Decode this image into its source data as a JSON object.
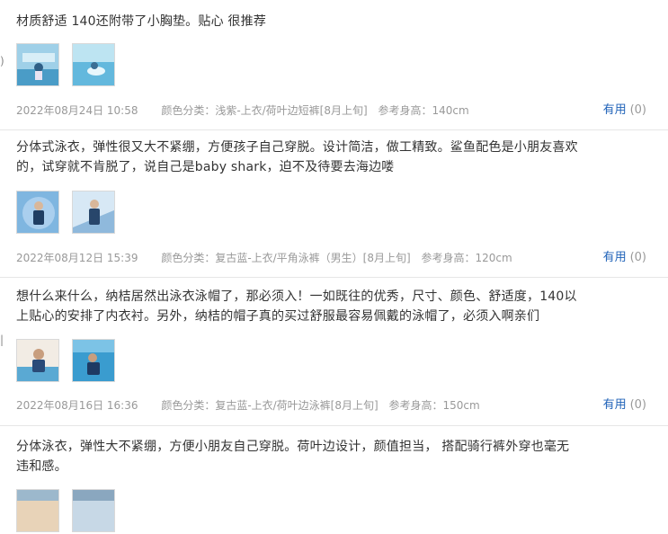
{
  "reviews": [
    {
      "lines": [
        "材质舒适 140还附带了小胸垫。贴心 很推荐"
      ],
      "date": "2022年08月24日 10:58",
      "spec": "颜色分类：浅紫-上衣/荷叶边短裤[8月上旬]",
      "height": "参考身高：140cm",
      "useful_label": "有用",
      "useful_count": "(0)"
    },
    {
      "lines": [
        "分体式泳衣，弹性很又大不紧绷，方便孩子自己穿脱。设计简洁，做工精致。鲨鱼配色是小朋友喜欢",
        "的，试穿就不肯脱了，说自己是baby shark，迫不及待要去海边喽"
      ],
      "date": "2022年08月12日 15:39",
      "spec": "颜色分类：复古蓝-上衣/平角泳裤（男生）[8月上旬]",
      "height": "参考身高：120cm",
      "useful_label": "有用",
      "useful_count": "(0)"
    },
    {
      "lines": [
        "想什么来什么，纳桔居然出泳衣泳帽了，那必须入！一如既往的优秀，尺寸、颜色、舒适度，140以",
        "上贴心的安排了内衣衬。另外，纳桔的帽子真的买过舒服最容易佩戴的泳帽了，必须入啊亲们"
      ],
      "date": "2022年08月16日 16:36",
      "spec": "颜色分类：复古蓝-上衣/荷叶边泳裤[8月上旬]",
      "height": "参考身高：150cm",
      "useful_label": "有用",
      "useful_count": "(0)"
    },
    {
      "lines": [
        "分体泳衣，弹性大不紧绷，方便小朋友自己穿脱。荷叶边设计，颜值担当， 搭配骑行裤外穿也毫无",
        "违和感。"
      ]
    }
  ],
  "icons": {
    "edge": "‹"
  }
}
